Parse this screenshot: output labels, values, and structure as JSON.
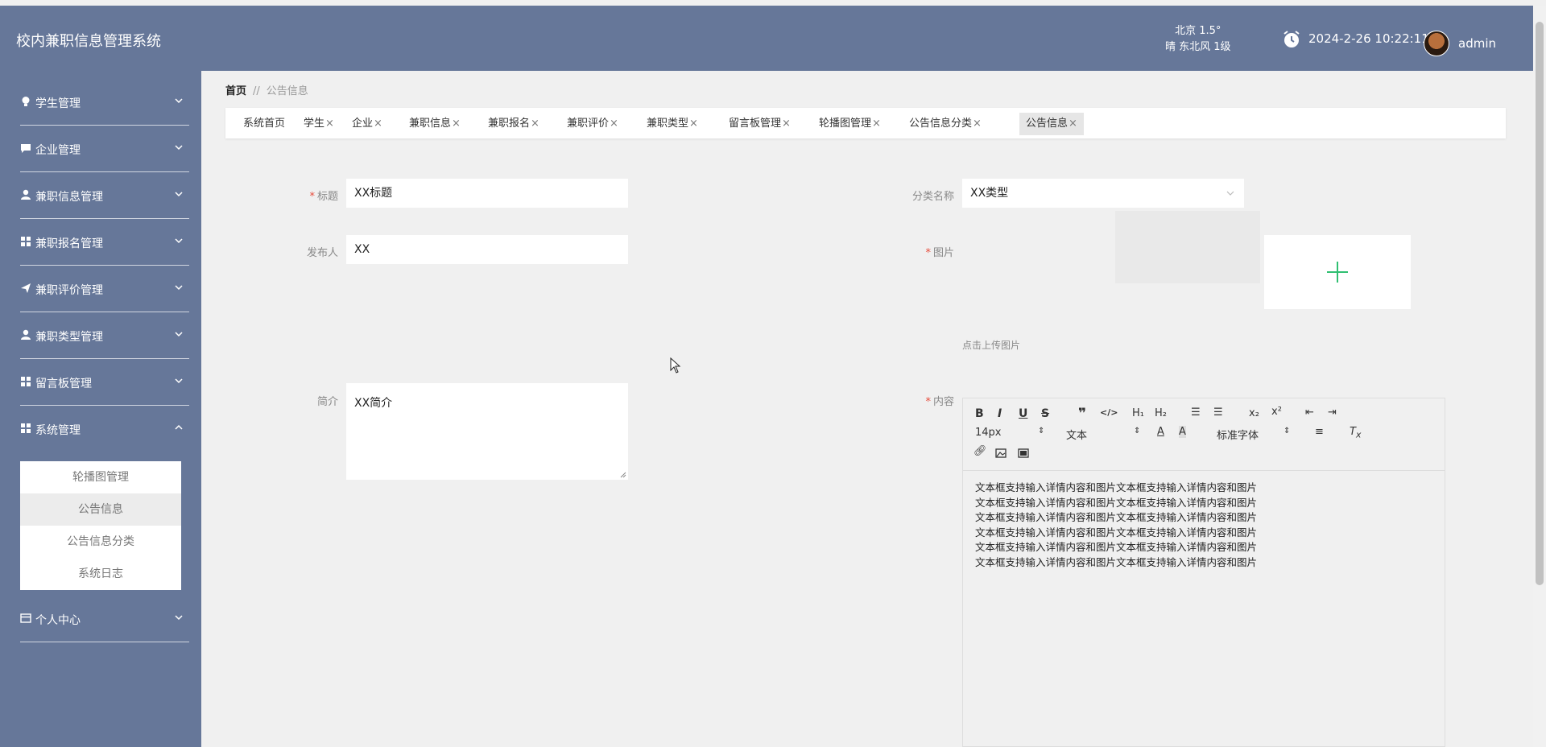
{
  "header": {
    "title": "校内兼职信息管理系统",
    "weather_line1": "北京 1.5°",
    "weather_line2": "晴 东北风 1级",
    "datetime": "2024-2-26 10:22:11",
    "username": "admin"
  },
  "sidebar": {
    "items": [
      {
        "label": "学生管理",
        "icon": "lightbulb-icon"
      },
      {
        "label": "企业管理",
        "icon": "message-icon"
      },
      {
        "label": "兼职信息管理",
        "icon": "user-icon"
      },
      {
        "label": "兼职报名管理",
        "icon": "grid-icon"
      },
      {
        "label": "兼职评价管理",
        "icon": "send-icon"
      },
      {
        "label": "兼职类型管理",
        "icon": "user-icon"
      },
      {
        "label": "留言板管理",
        "icon": "grid-icon"
      },
      {
        "label": "系统管理",
        "icon": "grid-icon"
      },
      {
        "label": "个人中心",
        "icon": "card-icon"
      }
    ],
    "submenu": [
      "轮播图管理",
      "公告信息",
      "公告信息分类",
      "系统日志"
    ]
  },
  "breadcrumb": {
    "home": "首页",
    "separator": "//",
    "current": "公告信息"
  },
  "tabs": [
    {
      "label": "系统首页",
      "close": ""
    },
    {
      "label": "学生",
      "close": "×"
    },
    {
      "label": "企业",
      "close": "×"
    },
    {
      "label": "兼职信息",
      "close": "×"
    },
    {
      "label": "兼职报名",
      "close": "×"
    },
    {
      "label": "兼职评价",
      "close": "×"
    },
    {
      "label": "兼职类型",
      "close": "×"
    },
    {
      "label": "留言板管理",
      "close": "×"
    },
    {
      "label": "轮播图管理",
      "close": "×"
    },
    {
      "label": "公告信息分类",
      "close": "×"
    },
    {
      "label": "公告信息",
      "close": "×"
    }
  ],
  "form": {
    "title_label": "标题",
    "title_value": "XX标题",
    "category_label": "分类名称",
    "category_value": "XX类型",
    "publisher_label": "发布人",
    "publisher_value": "XX",
    "image_label": "图片",
    "upload_hint": "点击上传图片",
    "intro_label": "简介",
    "intro_value": "XX简介",
    "content_label": "内容",
    "required_mark": "*"
  },
  "editor": {
    "font_size": "14px",
    "text_type": "文本",
    "font_family": "标准字体",
    "content_lines": [
      "文本框支持输入详情内容和图片文本框支持输入详情内容和图片",
      "文本框支持输入详情内容和图片文本框支持输入详情内容和图片",
      "文本框支持输入详情内容和图片文本框支持输入详情内容和图片",
      "文本框支持输入详情内容和图片文本框支持输入详情内容和图片",
      "文本框支持输入详情内容和图片文本框支持输入详情内容和图片",
      "文本框支持输入详情内容和图片文本框支持输入详情内容和图片"
    ]
  },
  "colors": {
    "header_bg": "#667799",
    "accent_green": "#2fbf71",
    "required_red": "#e74c3c"
  }
}
